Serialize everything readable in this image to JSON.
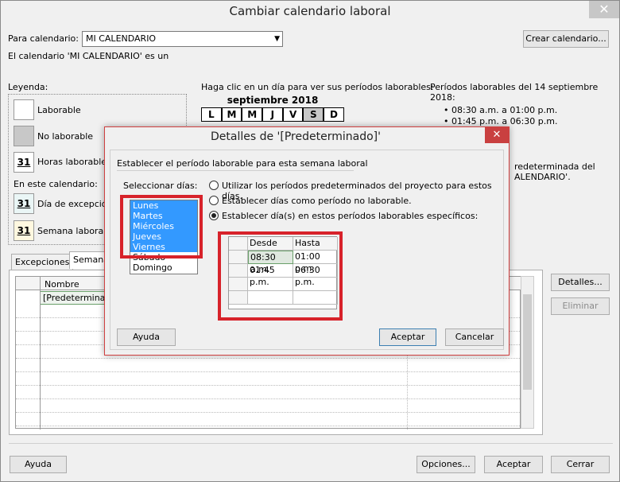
{
  "window": {
    "title": "Cambiar calendario laboral"
  },
  "calendar_for_label": "Para calendario:",
  "calendar_value": "MI CALENDARIO",
  "create_calendar_button": "Crear calendario...",
  "base_info": "El calendario 'MI CALENDARIO' es un",
  "legend": {
    "title": "Leyenda:",
    "working": "Laborable",
    "nonworking": "No laborable",
    "edited_hours": "Horas laborables",
    "in_this_calendar": "En este calendario:",
    "exception_day": "Día de excepció",
    "week": "Semana laboral n",
    "glyph31": "31"
  },
  "calendar": {
    "instruction": "Haga clic en un día para ver sus períodos laborables:",
    "month": "septiembre 2018",
    "weekdays": [
      "L",
      "M",
      "M",
      "J",
      "V",
      "S",
      "D"
    ]
  },
  "periods": {
    "title": "Períodos laborables del 14 septiembre 2018:",
    "items": [
      "• 08:30 a.m. a 01:00 p.m.",
      "• 01:45 p.m. a 06:30 p.m."
    ],
    "note_line1": "redeterminada del",
    "note_line2": "ALENDARIO'."
  },
  "tabs": {
    "exceptions": "Excepciones",
    "weeks": "Semana"
  },
  "table": {
    "col_name": "Nombre",
    "row1_name": "[Predeterminad"
  },
  "buttons": {
    "details": "Detalles...",
    "delete": "Eliminar",
    "help": "Ayuda",
    "options": "Opciones...",
    "accept": "Aceptar",
    "close": "Cerrar"
  },
  "modal": {
    "title": "Detalles de '[Predeterminado]'",
    "group_label": "Establecer el período laborable para esta semana laboral",
    "select_days_label": "Seleccionar días:",
    "days": [
      "Lunes",
      "Martes",
      "Miércoles",
      "Jueves",
      "Viernes",
      "Sábado",
      "Domingo"
    ],
    "radio1": "Utilizar los períodos predeterminados del proyecto para estos días.",
    "radio2": "Establecer días como período no laborable.",
    "radio3": "Establecer día(s) en estos períodos laborables específicos:",
    "col_from": "Desde",
    "col_to": "Hasta",
    "rows": [
      {
        "from": "08:30 a.m.",
        "to": "01:00 p.m."
      },
      {
        "from": "01:45 p.m.",
        "to": "06:30 p.m."
      }
    ],
    "help": "Ayuda",
    "accept": "Aceptar",
    "cancel": "Cancelar",
    "close_glyph": "✕"
  },
  "window_close_glyph": "✕",
  "colors": {
    "selection": "#3399ff",
    "highlight_box": "#d7222a",
    "close_red": "#c94040"
  }
}
